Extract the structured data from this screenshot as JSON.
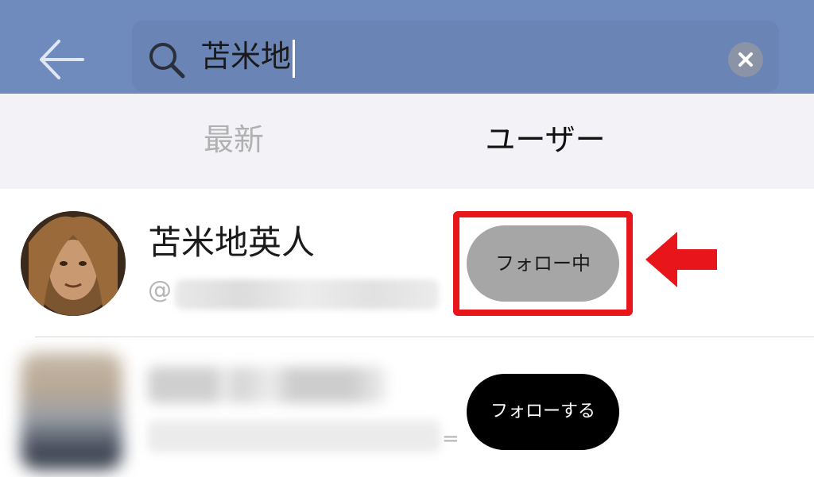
{
  "search": {
    "query": "苫米地"
  },
  "tabs": [
    {
      "label": "最新",
      "active": false
    },
    {
      "label": "ユーザー",
      "active": true
    }
  ],
  "results": [
    {
      "name": "苫米地英人",
      "handle_prefix": "@",
      "handle_blurred": true,
      "follow_label": "フォロー中",
      "following": true
    },
    {
      "name_blurred": true,
      "handle_blurred": true,
      "follow_label": "フォローする",
      "following": false,
      "trailing_mark": "="
    }
  ],
  "colors": {
    "header_bg": "#6f8bbd",
    "highlight_red": "#e8151b",
    "following_btn_bg": "#a6a6a6",
    "follow_btn_bg": "#000000"
  },
  "icons": [
    "back-arrow-icon",
    "search-icon",
    "clear-icon",
    "red-arrow-icon"
  ]
}
